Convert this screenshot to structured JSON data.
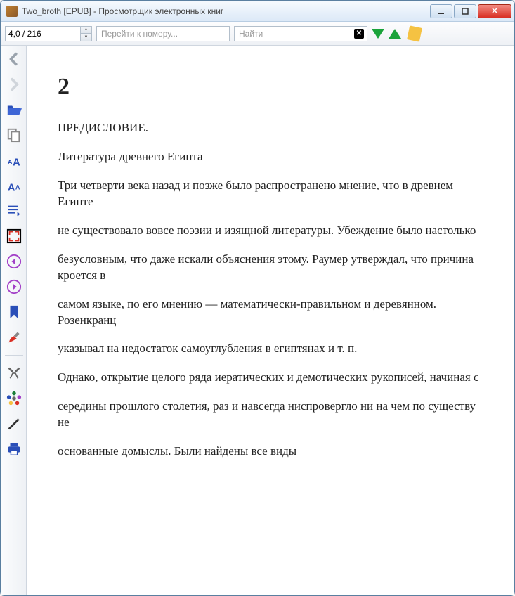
{
  "window": {
    "title": "Two_broth [EPUB] - Просмотрщик электронных книг"
  },
  "toolbar": {
    "page_position": "4,0 / 216",
    "goto_placeholder": "Перейти к номеру...",
    "search_placeholder": "Найти"
  },
  "document": {
    "chapter_number": "2",
    "paragraphs": [
      "ПРЕДИСЛОВИЕ.",
      "Литература древнего Египта",
      "Три четверти века назад и позже было распространено мнение, что в древнем Египте",
      "не существовало вовсе поэзии и изящной литературы. Убеждение было настолько",
      "безусловным, что даже искали объяснения этому. Раумер утверждал, что причина кроется в",
      "самом языке, по его мнению — математически-правильном и деревянном. Розенкранц",
      "указывал на недостаток самоуглубления в египтянах и т. п.",
      "Однако, открытие целого ряда иератических и демотических рукописей, начиная с",
      "середины прошлого столетия, раз и навсегда ниспровергло ни на чем по существу не",
      "основанные домыслы. Были найдены все виды"
    ]
  }
}
